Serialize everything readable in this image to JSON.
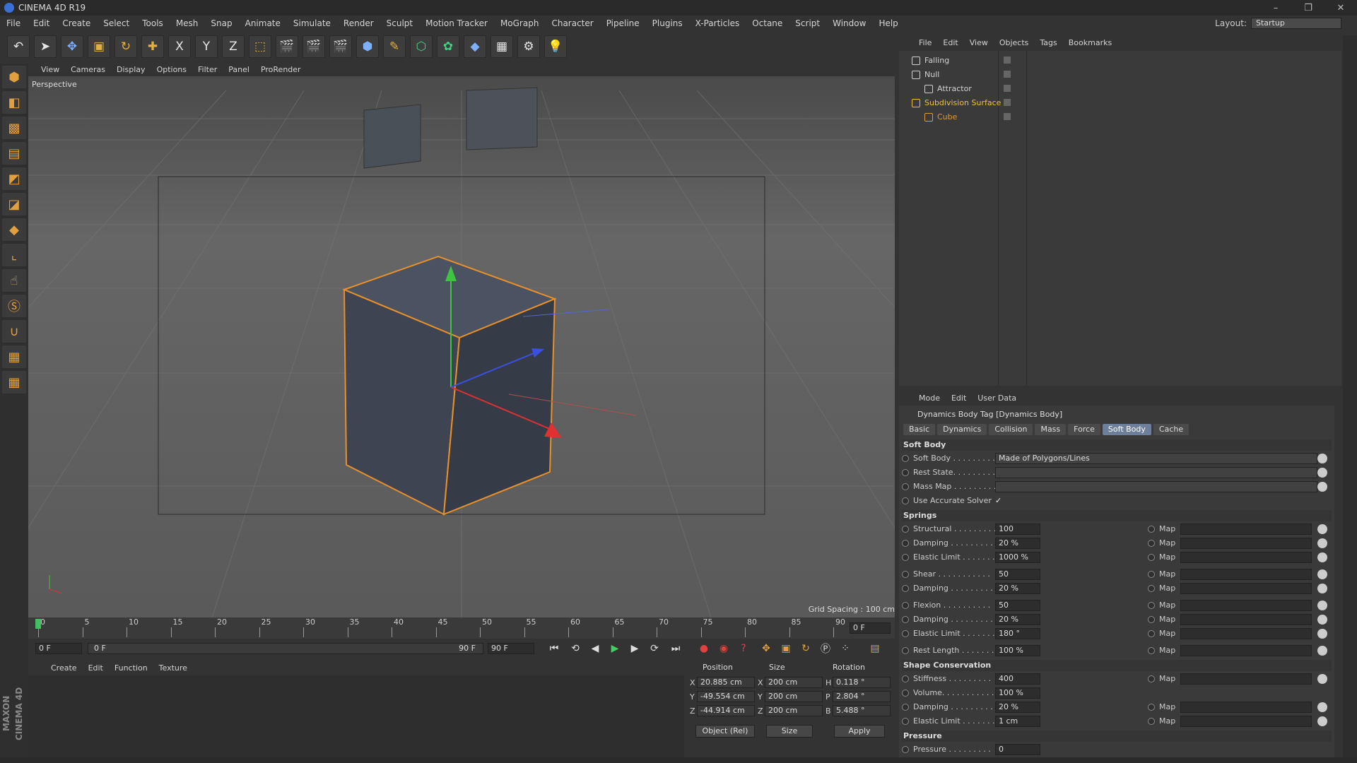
{
  "app": {
    "title": "CINEMA 4D R19",
    "brand": "MAXON CINEMA 4D"
  },
  "window_buttons": [
    "–",
    "❐",
    "✕"
  ],
  "menu": [
    "File",
    "Edit",
    "Create",
    "Select",
    "Tools",
    "Mesh",
    "Snap",
    "Animate",
    "Simulate",
    "Render",
    "Sculpt",
    "Motion Tracker",
    "MoGraph",
    "Character",
    "Pipeline",
    "Plugins",
    "X-Particles",
    "Octane",
    "Script",
    "Window",
    "Help"
  ],
  "layout": {
    "label": "Layout:",
    "value": "Startup"
  },
  "toolbar": [
    "↶",
    "➤",
    "✥",
    "▣",
    "↻",
    "✚",
    "X",
    "Y",
    "Z",
    "⬚",
    "🎬",
    "🎬",
    "🎬",
    "⬢",
    "✎",
    "⬡",
    "✿",
    "◆",
    "▦",
    "⚙",
    "💡"
  ],
  "viewport": {
    "menu": [
      "View",
      "Cameras",
      "Display",
      "Options",
      "Filter",
      "Panel",
      "ProRender"
    ],
    "label": "Perspective",
    "grid_spacing": "Grid Spacing : 100 cm"
  },
  "timeline": {
    "ticks": [
      "0",
      "5",
      "10",
      "15",
      "20",
      "25",
      "30",
      "35",
      "40",
      "45",
      "50",
      "55",
      "60",
      "65",
      "70",
      "75",
      "80",
      "85",
      "90"
    ],
    "current_frame": "0 F",
    "start": "0 F",
    "range_start": "0 F",
    "range_end": "90 F",
    "end": "90 F"
  },
  "materials_menu": [
    "Create",
    "Edit",
    "Function",
    "Texture"
  ],
  "coords": {
    "headers": {
      "position": "Position",
      "size": "Size",
      "rotation": "Rotation"
    },
    "rows": [
      {
        "axis": "X",
        "pos": "20.885 cm",
        "size_axis": "X",
        "size": "200 cm",
        "rot_axis": "H",
        "rot": "0.118 °"
      },
      {
        "axis": "Y",
        "pos": "-49.554 cm",
        "size_axis": "Y",
        "size": "200 cm",
        "rot_axis": "P",
        "rot": "2.804 °"
      },
      {
        "axis": "Z",
        "pos": "-44.914 cm",
        "size_axis": "Z",
        "size": "200 cm",
        "rot_axis": "B",
        "rot": "5.488 °"
      }
    ],
    "mode": "Object (Rel)",
    "size_mode": "Size",
    "apply": "Apply"
  },
  "object_manager": {
    "menu": [
      "File",
      "Edit",
      "View",
      "Objects",
      "Tags",
      "Bookmarks"
    ],
    "objects": [
      {
        "name": "Falling",
        "indent": 0,
        "color": "#d0d0d0"
      },
      {
        "name": "Null",
        "indent": 0,
        "color": "#d0d0d0"
      },
      {
        "name": "Attractor",
        "indent": 1,
        "color": "#d0d0d0"
      },
      {
        "name": "Subdivision Surface",
        "indent": 0,
        "color": "#f0c040"
      },
      {
        "name": "Cube",
        "indent": 1,
        "color": "#e09a30"
      }
    ]
  },
  "attributes": {
    "menu": [
      "Mode",
      "Edit",
      "User Data"
    ],
    "title": "Dynamics Body Tag [Dynamics Body]",
    "tabs": [
      "Basic",
      "Dynamics",
      "Collision",
      "Mass",
      "Force",
      "Soft Body",
      "Cache"
    ],
    "active_tab": "Soft Body",
    "sections": [
      {
        "title": "Soft Body",
        "rows": [
          {
            "label": "Soft Body . . . . . . . . .",
            "value": "Made of Polygons/Lines",
            "wide": true
          },
          {
            "label": "Rest State. . . . . . . . .",
            "value": "",
            "wide": true
          },
          {
            "label": "Mass Map . . . . . . . . .",
            "value": "",
            "wide": true
          },
          {
            "label": "Use Accurate Solver",
            "value": "✓",
            "check": true
          }
        ]
      },
      {
        "title": "Springs",
        "rows": [
          {
            "label": "Structural . . . . . . . . .",
            "value": "100",
            "map": "Map"
          },
          {
            "label": "Damping . . . . . . . . .",
            "value": "20 %",
            "map": "Map"
          },
          {
            "label": "Elastic Limit . . . . . . .",
            "value": "1000 %",
            "map": "Map"
          },
          {
            "gap": true
          },
          {
            "label": "Shear . . . . . . . . . . .",
            "value": "50",
            "map": "Map"
          },
          {
            "label": "Damping . . . . . . . . .",
            "value": "20 %",
            "map": "Map"
          },
          {
            "gap": true
          },
          {
            "label": "Flexion . . . . . . . . . .",
            "value": "50",
            "map": "Map"
          },
          {
            "label": "Damping . . . . . . . . .",
            "value": "20 %",
            "map": "Map"
          },
          {
            "label": "Elastic Limit . . . . . . .",
            "value": "180 °",
            "map": "Map"
          },
          {
            "gap": true
          },
          {
            "label": "Rest Length . . . . . . .",
            "value": "100 %",
            "map": "Map"
          }
        ]
      },
      {
        "title": "Shape Conservation",
        "rows": [
          {
            "label": "Stiffness . . . . . . . . .",
            "value": "400",
            "map": "Map"
          },
          {
            "label": "Volume. . . . . . . . . . .",
            "value": "100 %"
          },
          {
            "label": "Damping . . . . . . . . .",
            "value": "20 %",
            "map": "Map"
          },
          {
            "label": "Elastic Limit . . . . . . .",
            "value": "1 cm",
            "map": "Map"
          }
        ]
      },
      {
        "title": "Pressure",
        "rows": [
          {
            "label": "Pressure . . . . . . . . .",
            "value": "0"
          }
        ]
      }
    ]
  }
}
